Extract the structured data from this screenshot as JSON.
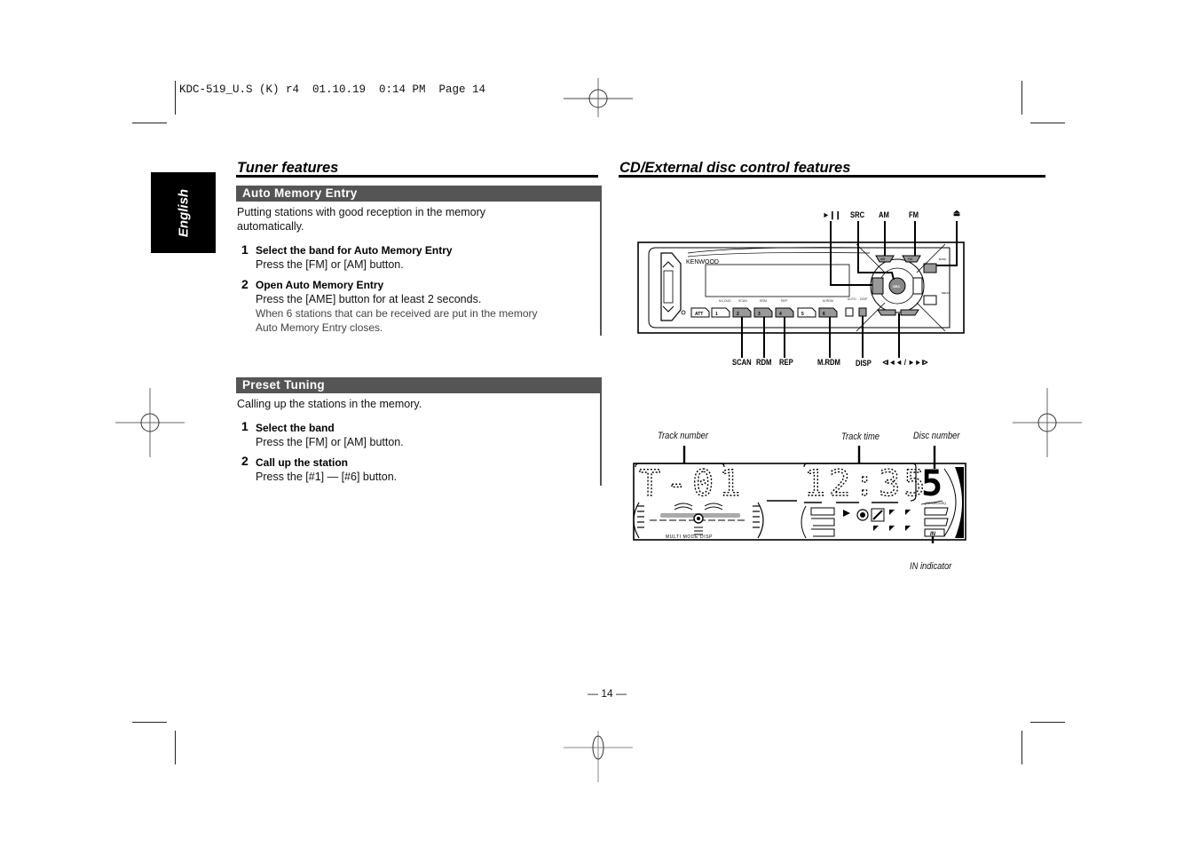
{
  "print_header": "KDC-519_U.S (K) r4  01.10.19  0:14 PM  Page 14",
  "language_tab": "English",
  "left": {
    "section_title": "Tuner features",
    "subsections": [
      {
        "title": "Auto Memory Entry",
        "intro": [
          "Putting stations with good reception in the memory",
          "automatically."
        ],
        "steps": [
          {
            "num": "1",
            "title": "Select the band for Auto Memory Entry",
            "lines": [
              "Press the [FM] or [AM] button."
            ],
            "notes": []
          },
          {
            "num": "2",
            "title": "Open Auto Memory Entry",
            "lines": [
              "Press the [AME] button for at least 2 seconds."
            ],
            "notes": [
              "When 6 stations that can be received are put in the memory",
              "Auto Memory Entry closes."
            ]
          }
        ]
      },
      {
        "title": "Preset Tuning",
        "intro": [
          "Calling up the stations in the memory."
        ],
        "steps": [
          {
            "num": "1",
            "title": "Select the band",
            "lines": [
              "Press the [FM] or [AM] button."
            ],
            "notes": []
          },
          {
            "num": "2",
            "title": "Call up the station",
            "lines": [
              "Press the [#1] — [#6] button."
            ],
            "notes": []
          }
        ]
      }
    ]
  },
  "right": {
    "section_title": "CD/External disc control features",
    "faceplate": {
      "brand": "KENWOOD",
      "top_labels": {
        "play_pause": "►❙❙",
        "src": "SRC",
        "am": "AM",
        "fm": "FM",
        "eject": "⏏"
      },
      "bottom_labels": {
        "scan": "SCAN",
        "rdm": "RDM",
        "rep": "REP",
        "mrdm": "M.RDM",
        "disp": "DISP",
        "track": "⧏◄◄ / ►►⧐"
      },
      "preset_buttons": [
        "ATT",
        "1",
        "2",
        "3",
        "4",
        "5",
        "6"
      ],
      "knob_label": "SRC",
      "button_am": "AM",
      "button_fm": "FM"
    },
    "display": {
      "track_number_caption": "Track number",
      "track_time_caption": "Track time",
      "disc_number_caption": "Disc number",
      "in_indicator_caption": "IN indicator",
      "track_value": "T-01",
      "time_value": "12:35",
      "disc_value": "5",
      "mode_text": "MULTI MODE DISP",
      "in_text": "IN"
    }
  },
  "page_number": "— 14 —"
}
